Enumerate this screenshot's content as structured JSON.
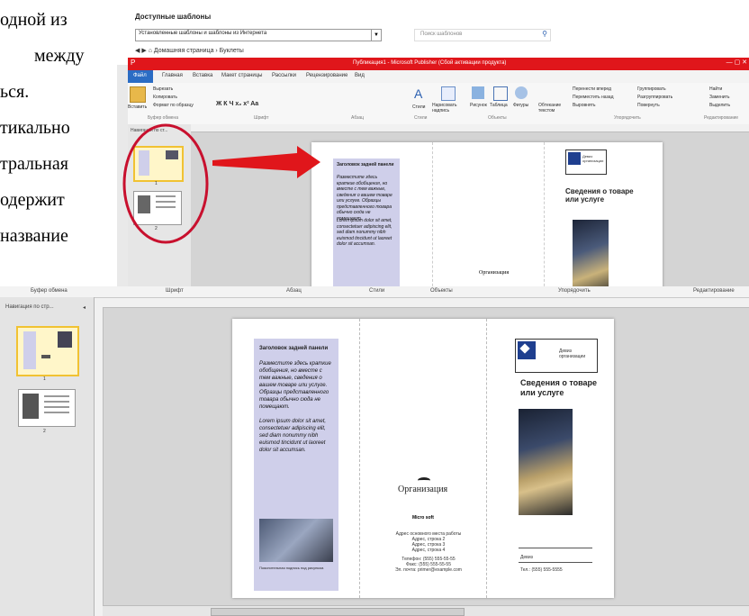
{
  "left_text": [
    "одной из",
    "между",
    "ься.",
    "тикально",
    "тральная",
    "одержит",
    "название"
  ],
  "shot1": {
    "templates": {
      "heading": "Доступные шаблоны",
      "dropdown_value": "Установленные шаблоны и шаблоны из Интернета",
      "search_placeholder": "Поиск шаблонов",
      "breadcrumb": "Домашняя страница › Буклеты"
    },
    "titlebar": "Публикация1 - Microsoft Publisher (Сбой активации продукта)",
    "tabs": [
      "Файл",
      "Главная",
      "Вставка",
      "Макет страницы",
      "Рассылки",
      "Рецензирование",
      "Вид"
    ],
    "clipboard": {
      "paste": "Вставить",
      "cut": "Вырезать",
      "copy": "Копировать",
      "format": "Формат по образцу",
      "group": "Буфер обмена"
    },
    "groups": [
      "Шрифт",
      "Абзац",
      "Стили",
      "Объекты",
      "Упорядочить",
      "Редактирование"
    ],
    "objects": {
      "text": "Нарисовать надпись",
      "picture": "Рисунок",
      "table": "Таблица",
      "shapes": "Фигуры"
    },
    "styles": "Стили",
    "arrange": [
      "Перенести вперед",
      "Переместить назад",
      "Выровнять",
      "Группировать",
      "Разгруппировать",
      "Повернуть"
    ],
    "wrap": "Обтекание текстом",
    "editing": [
      "Найти",
      "Заменить",
      "Выделить"
    ],
    "nav_label": "Навигация по ст...",
    "thumb_numbers": [
      "1",
      "2"
    ]
  },
  "shot2": {
    "groups": [
      "Буфер обмена",
      "Шрифт",
      "Абзац",
      "Стили",
      "Объекты",
      "Упорядочить",
      "Редактирование"
    ],
    "nav_label": "Навигация по стр...",
    "thumb_numbers": [
      "1",
      "2"
    ]
  },
  "brochure": {
    "back_heading": "Заголовок задней панели",
    "back_body": "Разместите здесь краткие обобщения, но вместе с тем важные, сведения о вашем товаре или услуге. Образцы представленного товара обычно сюда не помещают.",
    "lorem": "Lorem ipsum dolor sit amet, consectetuer adipiscing elit, sed diam nonummy nibh euismod tincidunt ut laoreet dolor sit accumsan.",
    "caption": "Пояснительная подпись под рисунком.",
    "org_name": "Организация",
    "company": "Micro soft",
    "address": [
      "Адрес основного места работы",
      "Адрес, строка 2",
      "Адрес, строка 3",
      "Адрес, строка 4"
    ],
    "phone": "Телефон: (555) 555-55-55",
    "fax": "Факс: (555) 555-55-55",
    "email": "Эл. почта: primer@example.com",
    "cover_org": "Девиз организации",
    "cover_title": "Сведения о товаре или услуге",
    "slogan": "Девиз",
    "cover_phone": "Тел.: (555) 555-5555"
  },
  "colors": {
    "arrow": "#e0161b",
    "highlight_circle": "#c8102e",
    "titlebar": "#e0161b",
    "panel": "#cfcfea",
    "logo_blue": "#1f3f8f"
  }
}
